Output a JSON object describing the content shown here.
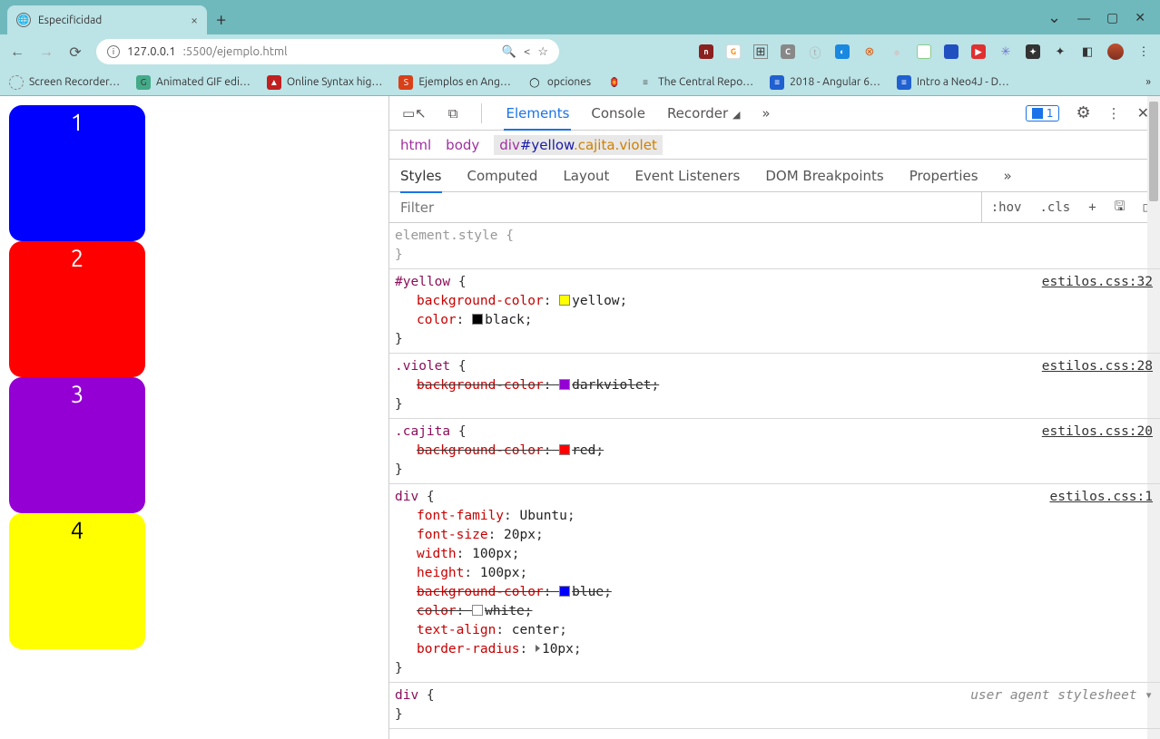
{
  "browser": {
    "tab_title": "Especificidad",
    "url_host": "127.0.0.1",
    "url_port_path": ":5500/ejemplo.html",
    "bookmarks": [
      "Screen Recorder…",
      "Animated GIF edi…",
      "Online Syntax hig…",
      "Ejemplos en Ang…",
      "opciones",
      "The Central Repo…",
      "2018 - Angular 6…",
      "Intro a Neo4J - D…"
    ]
  },
  "page_boxes": [
    {
      "n": "1",
      "bg": "#0000ff",
      "fg": "#ffffff"
    },
    {
      "n": "2",
      "bg": "#ff0000",
      "fg": "#ffffff"
    },
    {
      "n": "3",
      "bg": "#9400d3",
      "fg": "#ffffff"
    },
    {
      "n": "4",
      "bg": "#ffff00",
      "fg": "#000000"
    }
  ],
  "devtools": {
    "issues_count": "1",
    "tabs": [
      "Elements",
      "Console",
      "Recorder"
    ],
    "breadcrumb": {
      "html": "html",
      "body": "body",
      "tag": "div",
      "id": "#yellow",
      "cls": ".cajita.violet"
    },
    "subtabs": [
      "Styles",
      "Computed",
      "Layout",
      "Event Listeners",
      "DOM Breakpoints",
      "Properties"
    ],
    "filter_placeholder": "Filter",
    "hov": ":hov",
    "cls": ".cls",
    "element_style": "element.style",
    "rules": [
      {
        "selector": "#yellow",
        "source": "estilos.css:32",
        "props": [
          {
            "name": "background-color",
            "value": "yellow",
            "swatch": "#ffff00",
            "strike": false
          },
          {
            "name": "color",
            "value": "black",
            "swatch": "#000000",
            "strike": false
          }
        ]
      },
      {
        "selector": ".violet",
        "source": "estilos.css:28",
        "props": [
          {
            "name": "background-color",
            "value": "darkviolet",
            "swatch": "#9400d3",
            "strike": true
          }
        ]
      },
      {
        "selector": ".cajita",
        "source": "estilos.css:20",
        "props": [
          {
            "name": "background-color",
            "value": "red",
            "swatch": "#ff0000",
            "strike": true
          }
        ]
      },
      {
        "selector": "div",
        "source": "estilos.css:1",
        "props": [
          {
            "name": "font-family",
            "value": "Ubuntu",
            "strike": false
          },
          {
            "name": "font-size",
            "value": "20px",
            "strike": false
          },
          {
            "name": "width",
            "value": "100px",
            "strike": false
          },
          {
            "name": "height",
            "value": "100px",
            "strike": false
          },
          {
            "name": "background-color",
            "value": "blue",
            "swatch": "#0000ff",
            "strike": true
          },
          {
            "name": "color",
            "value": "white",
            "swatch": "#ffffff",
            "strike": true
          },
          {
            "name": "text-align",
            "value": "center",
            "strike": false
          },
          {
            "name": "border-radius",
            "value": "10px",
            "expand": true,
            "strike": false
          }
        ]
      },
      {
        "selector": "div",
        "source": "user agent stylesheet",
        "ua": true,
        "props": []
      }
    ]
  }
}
